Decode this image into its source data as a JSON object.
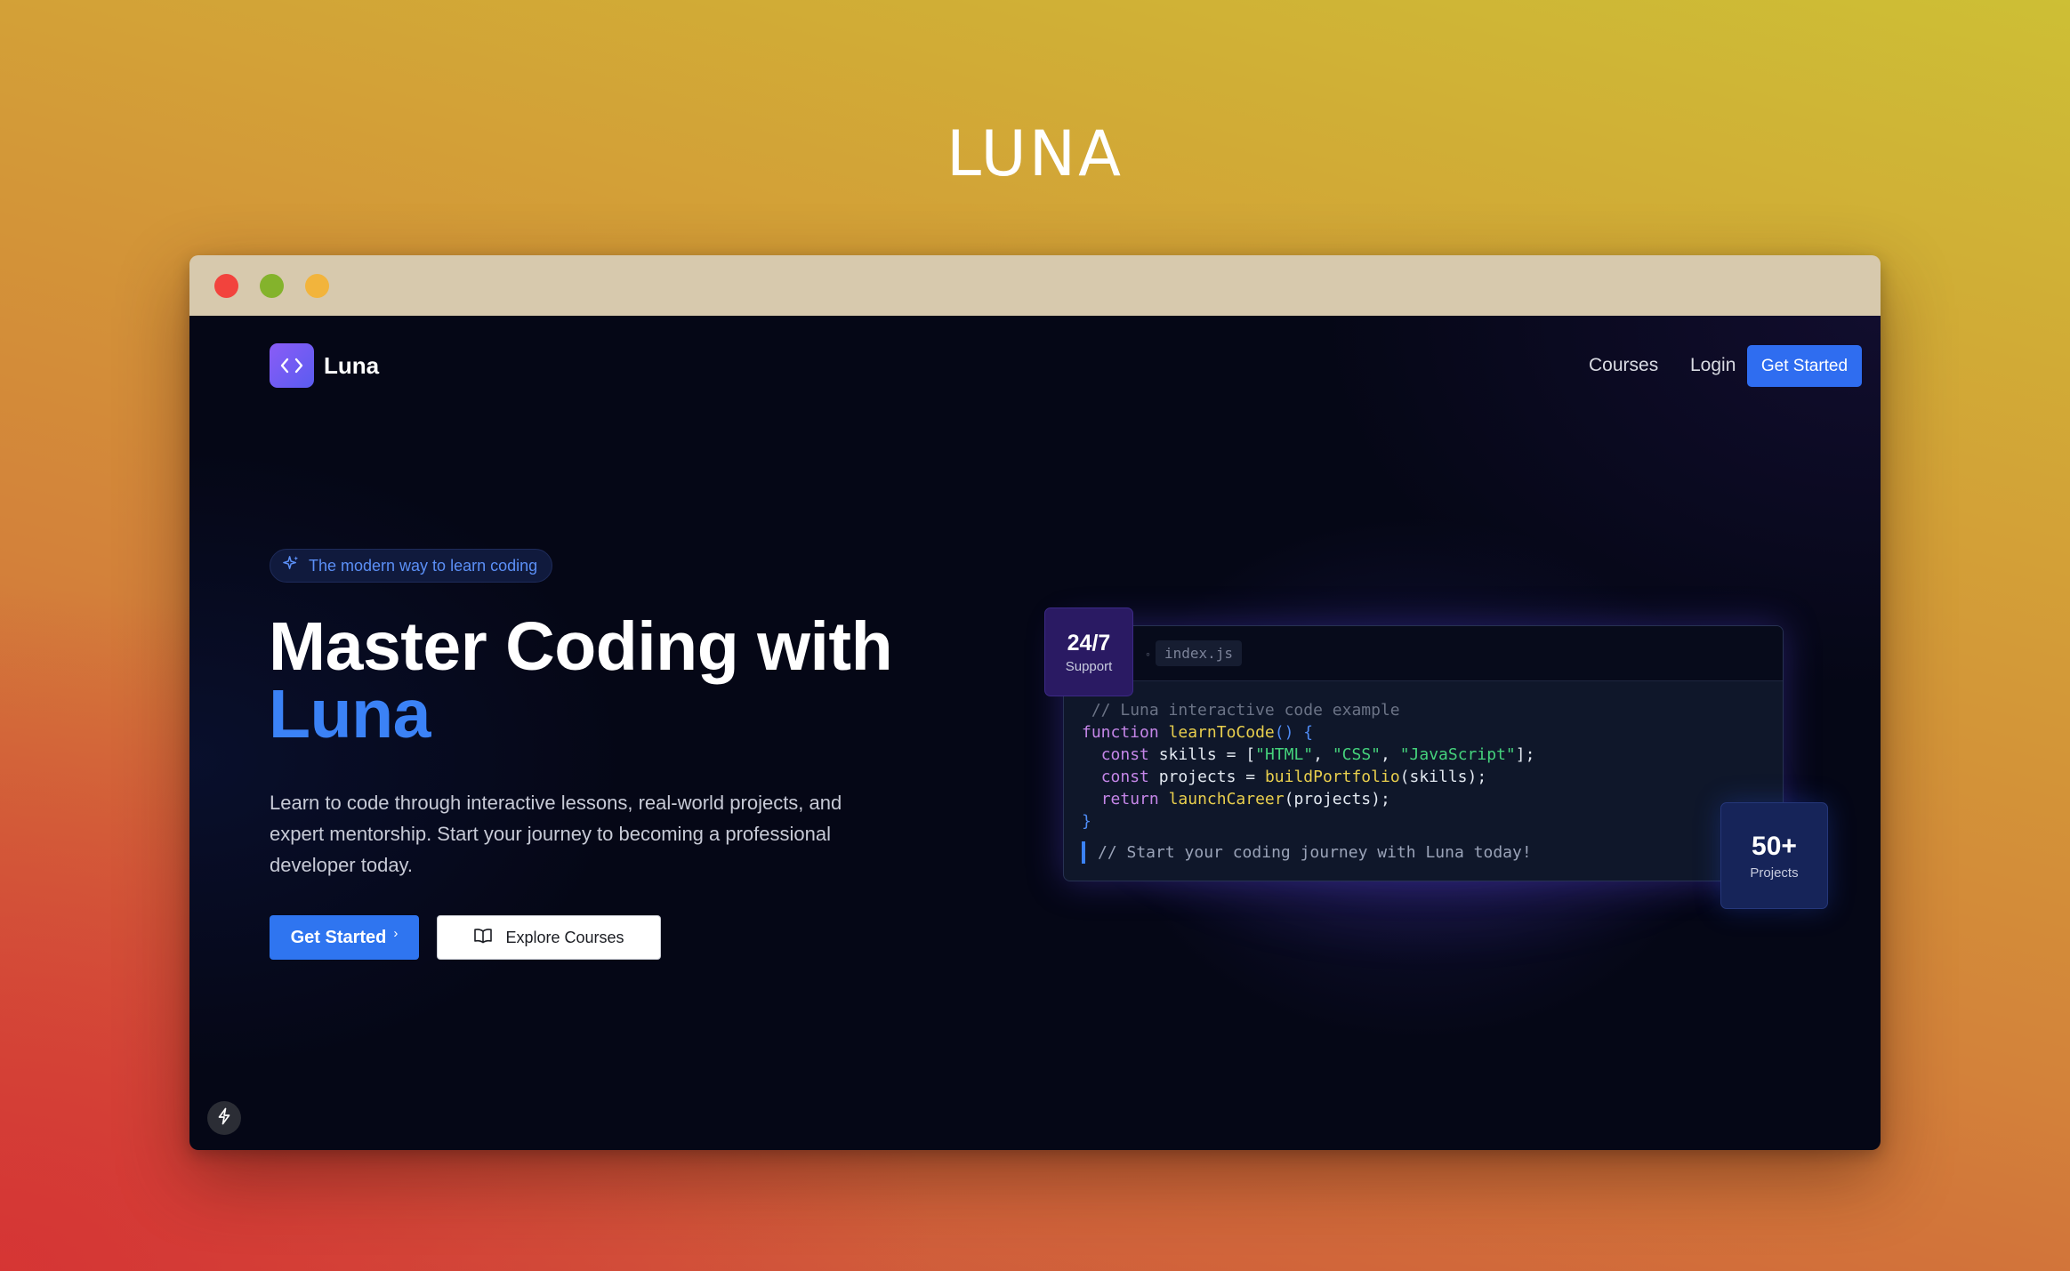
{
  "showcase": {
    "title": "LUNA"
  },
  "nav": {
    "brand": "Luna",
    "brand_icon": "code-brackets-icon",
    "links": [
      "Courses",
      "Login"
    ],
    "cta": "Get Started"
  },
  "hero": {
    "badge": "The modern way to learn coding",
    "badge_icon": "sparkles-icon",
    "headline_line1": "Master Coding with",
    "headline_accent": "Luna",
    "description": "Learn to code through interactive lessons, real-world projects, and expert mentorship. Start your journey to becoming a professional developer today.",
    "primary_button": "Get Started",
    "primary_button_icon": "chevron-right-icon",
    "secondary_button": "Explore Courses",
    "secondary_button_icon": "open-book-icon"
  },
  "code_card": {
    "filename": "index.js",
    "comment_top": "// Luna interactive code example",
    "kw_function": "function",
    "fn_learn": "learnToCode",
    "kw_const": "const",
    "var_skills": "skills",
    "str_html": "\"HTML\"",
    "str_css": "\"CSS\"",
    "str_js": "\"JavaScript\"",
    "var_projects": "projects",
    "fn_build": "buildPortfolio",
    "kw_return": "return",
    "fn_launch": "launchCareer",
    "comment_bottom": "// Start your coding journey with Luna today!"
  },
  "stats": {
    "support_value": "24/7",
    "support_label": "Support",
    "projects_value": "50+",
    "projects_label": "Projects"
  },
  "colors": {
    "accent": "#3b82f6",
    "button_blue": "#2f75f0",
    "background": "#050716"
  }
}
